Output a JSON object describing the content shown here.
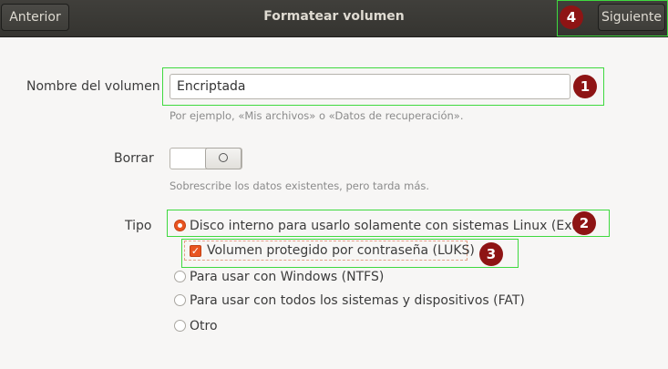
{
  "header": {
    "back_label": "Anterior",
    "title": "Formatear volumen",
    "next_label": "Siguiente"
  },
  "form": {
    "name_label": "Nombre del volumen",
    "name_value": "Encriptada",
    "name_help": "Por ejemplo, «Mis archivos» o «Datos de recuperación».",
    "erase_label": "Borrar",
    "erase_state": "off",
    "erase_help": "Sobrescribe los datos existentes, pero tarda más.",
    "type_label": "Tipo",
    "type_options": [
      "Disco interno para usarlo solamente con sistemas Linux (Ext4)",
      "Para usar con Windows (NTFS)",
      "Para usar con todos los sistemas y dispositivos (FAT)",
      "Otro"
    ],
    "selected_type": "Disco interno para usarlo solamente con sistemas Linux (Ext4)",
    "luks_label": "Volumen protegido por contraseña (LUKS)",
    "luks_checked": true
  },
  "annotations": [
    "1",
    "2",
    "3",
    "4"
  ],
  "colors": {
    "accent": "#e95420",
    "highlight": "#3fd93f",
    "badge": "#8e1414"
  }
}
